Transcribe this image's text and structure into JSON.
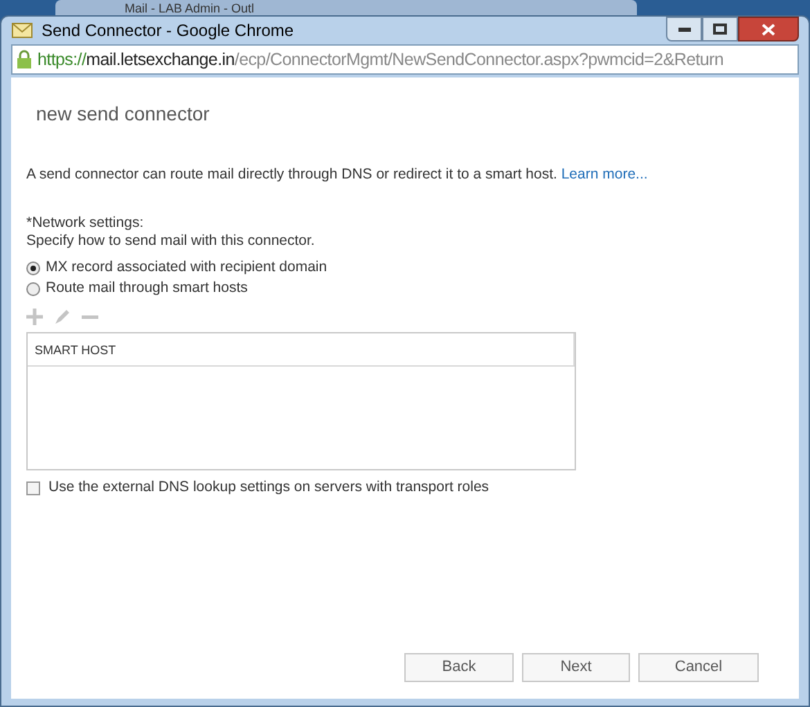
{
  "background_tab": {
    "title": "Mail - LAB Admin - Outl"
  },
  "window": {
    "title": "Send Connector - Google Chrome"
  },
  "address_bar": {
    "scheme": "https://",
    "host": "mail.letsexchange.in",
    "path": "/ecp/ConnectorMgmt/NewSendConnector.aspx?pwmcid=2&Return"
  },
  "page": {
    "heading": "new send connector",
    "description": "A send connector can route mail directly through DNS or redirect it to a smart host.",
    "learn_more": "Learn more...",
    "network_label": "*Network settings:",
    "network_hint": "Specify how to send mail with this connector.",
    "options": [
      {
        "label": "MX record associated with recipient domain",
        "selected": true
      },
      {
        "label": "Route mail through smart hosts",
        "selected": false
      }
    ],
    "toolbar": [
      {
        "kind": "add",
        "disabled": true
      },
      {
        "kind": "edit",
        "disabled": true
      },
      {
        "kind": "remove",
        "disabled": true
      }
    ],
    "table": {
      "columns": [
        "SMART HOST"
      ]
    },
    "external_dns": {
      "label": "Use the external DNS lookup settings on servers with transport roles",
      "checked": false
    }
  },
  "buttons": [
    {
      "label": "Back"
    },
    {
      "label": "Next"
    },
    {
      "label": "Cancel"
    }
  ]
}
